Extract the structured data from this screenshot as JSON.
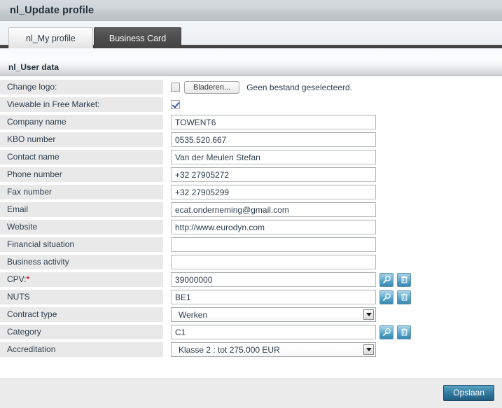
{
  "window": {
    "title": "nl_Update profile"
  },
  "tabs": [
    {
      "label": "nl_My profile",
      "active": false
    },
    {
      "label": "Business Card",
      "active": true
    }
  ],
  "section": {
    "title": "nl_User data"
  },
  "form": {
    "change_logo": {
      "label": "Change logo:",
      "checkbox_checked": false,
      "browse_label": "Bladeren...",
      "file_status": "Geen bestand geselecteerd."
    },
    "viewable": {
      "label": "Viewable in Free Market:",
      "checkbox_checked": true
    },
    "fields": [
      {
        "label": "Company name",
        "value": "TOWENT6",
        "type": "text"
      },
      {
        "label": "KBO number",
        "value": "0535.520.667",
        "type": "text"
      },
      {
        "label": "Contact name",
        "value": "Van der Meulen Stefan",
        "type": "text"
      },
      {
        "label": "Phone number",
        "value": "+32 27905272",
        "type": "text"
      },
      {
        "label": "Fax number",
        "value": "+32 27905299",
        "type": "text"
      },
      {
        "label": "Email",
        "value": "ecat.onderneming@gmail.com",
        "type": "text"
      },
      {
        "label": "Website",
        "value": "http://www.eurodyn.com",
        "type": "text"
      },
      {
        "label": "Financial situation",
        "value": "",
        "type": "text"
      },
      {
        "label": "Business activity",
        "value": "",
        "type": "text"
      },
      {
        "label": "CPV:",
        "value": "39000000",
        "type": "text-icons",
        "required": true
      },
      {
        "label": "NUTS",
        "value": "BE1",
        "type": "text-icons"
      },
      {
        "label": "Contract type",
        "value": "Werken",
        "type": "select"
      },
      {
        "label": "Category",
        "value": "C1",
        "type": "text-icons"
      },
      {
        "label": "Accreditation",
        "value": "Klasse 2 : tot 275.000 EUR",
        "type": "select"
      }
    ],
    "icons": {
      "search": "search-icon",
      "delete": "trash-icon"
    }
  },
  "footer": {
    "save_label": "Opslaan"
  },
  "colors": {
    "accent_blue": "#3b88af",
    "required_red": "#cc2b3c",
    "label_bg": "#e9e9e9",
    "active_tab_bg": "#4e4e4e"
  }
}
